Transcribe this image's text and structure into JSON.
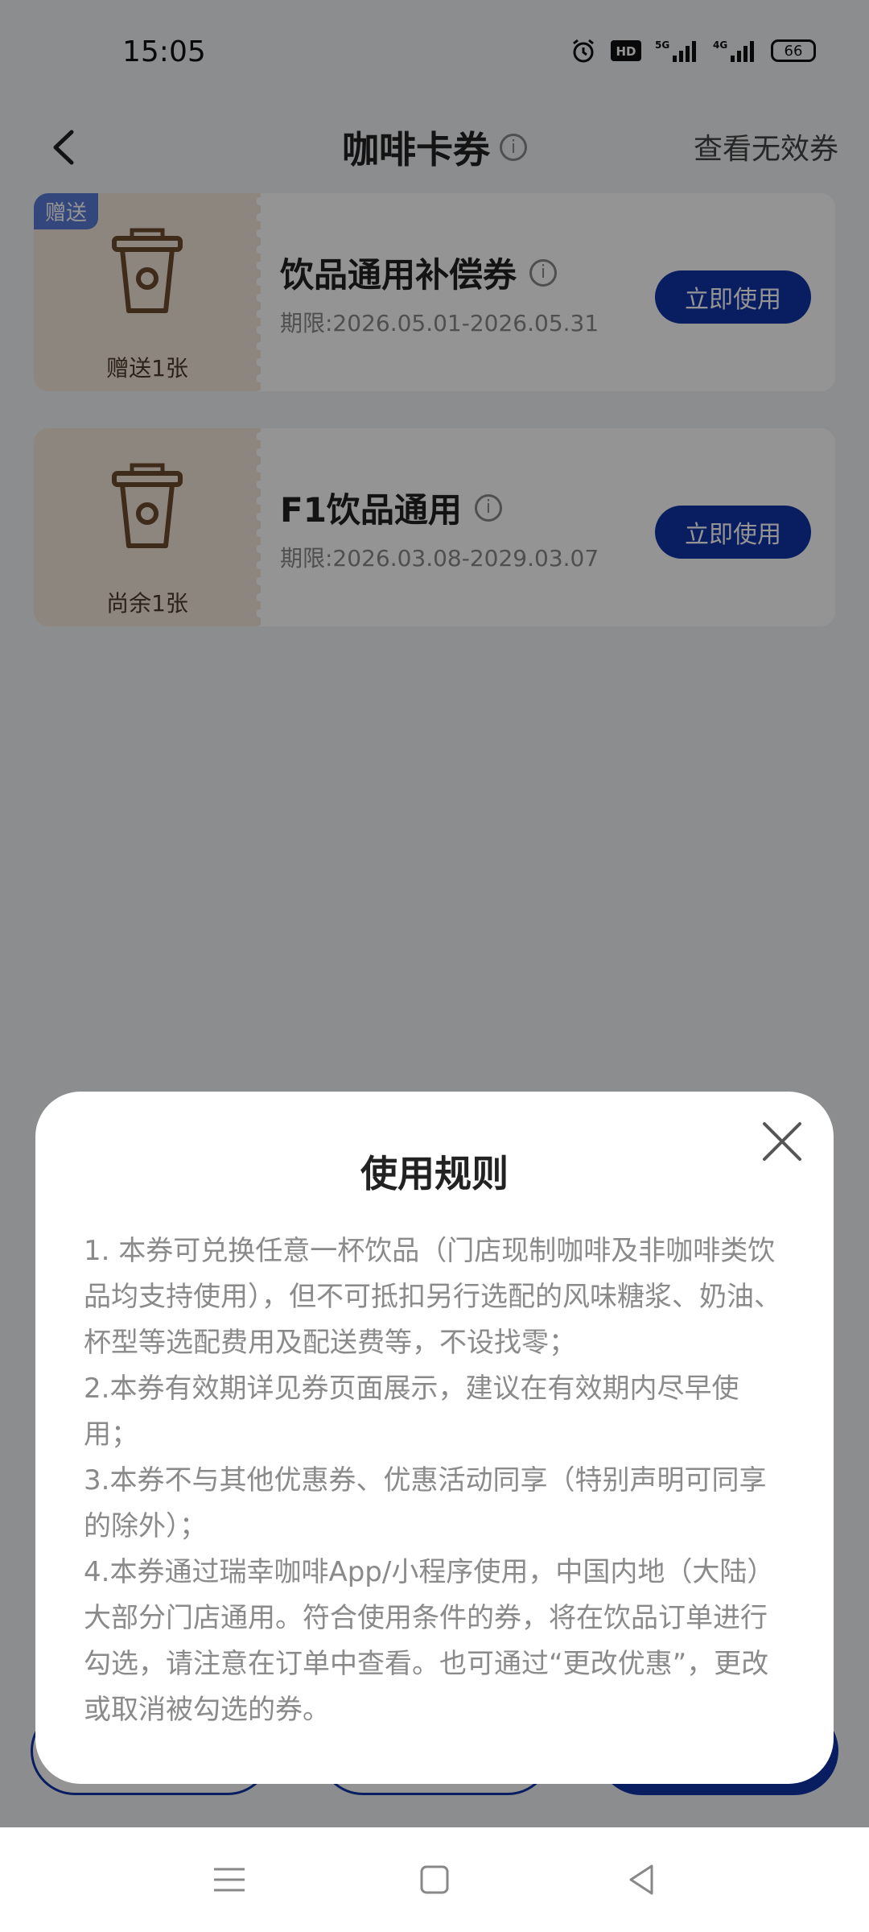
{
  "status": {
    "time": "15:05",
    "battery": "66"
  },
  "nav": {
    "title": "咖啡卡券",
    "right_link": "查看无效券"
  },
  "coupons": [
    {
      "tag": "赠送",
      "count": "赠送1张",
      "name": "饮品通用补偿券",
      "period": "期限:2026.05.01-2026.05.31",
      "button": "立即使用"
    },
    {
      "tag": "",
      "count": "尚余1张",
      "name": "F1饮品通用",
      "period": "期限:2026.03.08-2029.03.07",
      "button": "立即使用"
    }
  ],
  "modal": {
    "title": "使用规则",
    "rules": [
      "1. 本券可兑换任意一杯饮品（门店现制咖啡及非咖啡类饮品均支持使用），但不可抵扣另行选配的风味糖浆、奶油、杯型等选配费用及配送费等，不设找零；",
      "2.本券有效期详见券页面展示，建议在有效期内尽早使用；",
      "3.本券不与其他优惠券、优惠活动同享（特别声明可同享的除外）；",
      "4.本券通过瑞幸咖啡App/小程序使用，中国内地（大陆）大部分门店通用。符合使用条件的券，将在饮品订单进行勾选，请注意在订单中查看。也可通过“更改优惠”，更改或取消被勾选的券。"
    ]
  },
  "colors": {
    "accent": "#1033a8",
    "tag": "#5b7ad6",
    "coupon_left": "#f3e7da"
  }
}
